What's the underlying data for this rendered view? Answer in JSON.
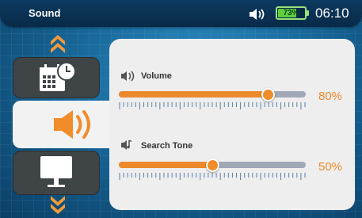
{
  "status_bar": {
    "title": "Sound",
    "battery_percent": "73%",
    "battery_level": 0.73,
    "time": "06:10"
  },
  "menu": {
    "items": [
      {
        "name": "calendar",
        "icon": "calendar-clock-icon"
      },
      {
        "name": "sound",
        "icon": "speaker-icon",
        "selected": true
      },
      {
        "name": "display",
        "icon": "monitor-icon"
      }
    ]
  },
  "settings": {
    "volume": {
      "label": "Volume",
      "value_text": "80%",
      "value": 80
    },
    "search_tone": {
      "label": "Search Tone",
      "value_text": "50%",
      "value": 50
    }
  },
  "colors": {
    "accent": "#ec8a2b",
    "panel": "#eeeeee",
    "battery": "#5fcf3e",
    "header": "#0b3152"
  }
}
